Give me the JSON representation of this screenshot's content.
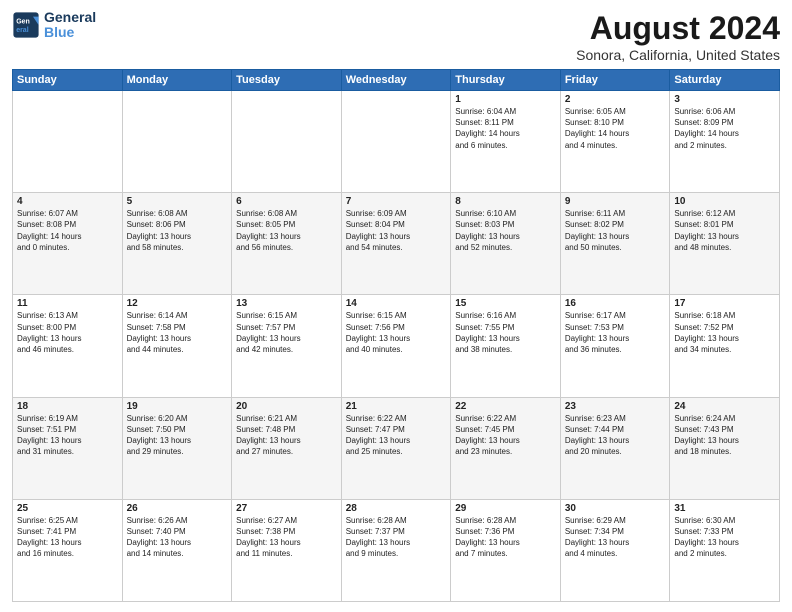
{
  "header": {
    "logo": {
      "line1": "General",
      "line2": "Blue"
    },
    "title": "August 2024",
    "subtitle": "Sonora, California, United States"
  },
  "days_of_week": [
    "Sunday",
    "Monday",
    "Tuesday",
    "Wednesday",
    "Thursday",
    "Friday",
    "Saturday"
  ],
  "weeks": [
    [
      {
        "day": "",
        "info": ""
      },
      {
        "day": "",
        "info": ""
      },
      {
        "day": "",
        "info": ""
      },
      {
        "day": "",
        "info": ""
      },
      {
        "day": "1",
        "info": "Sunrise: 6:04 AM\nSunset: 8:11 PM\nDaylight: 14 hours\nand 6 minutes."
      },
      {
        "day": "2",
        "info": "Sunrise: 6:05 AM\nSunset: 8:10 PM\nDaylight: 14 hours\nand 4 minutes."
      },
      {
        "day": "3",
        "info": "Sunrise: 6:06 AM\nSunset: 8:09 PM\nDaylight: 14 hours\nand 2 minutes."
      }
    ],
    [
      {
        "day": "4",
        "info": "Sunrise: 6:07 AM\nSunset: 8:08 PM\nDaylight: 14 hours\nand 0 minutes."
      },
      {
        "day": "5",
        "info": "Sunrise: 6:08 AM\nSunset: 8:06 PM\nDaylight: 13 hours\nand 58 minutes."
      },
      {
        "day": "6",
        "info": "Sunrise: 6:08 AM\nSunset: 8:05 PM\nDaylight: 13 hours\nand 56 minutes."
      },
      {
        "day": "7",
        "info": "Sunrise: 6:09 AM\nSunset: 8:04 PM\nDaylight: 13 hours\nand 54 minutes."
      },
      {
        "day": "8",
        "info": "Sunrise: 6:10 AM\nSunset: 8:03 PM\nDaylight: 13 hours\nand 52 minutes."
      },
      {
        "day": "9",
        "info": "Sunrise: 6:11 AM\nSunset: 8:02 PM\nDaylight: 13 hours\nand 50 minutes."
      },
      {
        "day": "10",
        "info": "Sunrise: 6:12 AM\nSunset: 8:01 PM\nDaylight: 13 hours\nand 48 minutes."
      }
    ],
    [
      {
        "day": "11",
        "info": "Sunrise: 6:13 AM\nSunset: 8:00 PM\nDaylight: 13 hours\nand 46 minutes."
      },
      {
        "day": "12",
        "info": "Sunrise: 6:14 AM\nSunset: 7:58 PM\nDaylight: 13 hours\nand 44 minutes."
      },
      {
        "day": "13",
        "info": "Sunrise: 6:15 AM\nSunset: 7:57 PM\nDaylight: 13 hours\nand 42 minutes."
      },
      {
        "day": "14",
        "info": "Sunrise: 6:15 AM\nSunset: 7:56 PM\nDaylight: 13 hours\nand 40 minutes."
      },
      {
        "day": "15",
        "info": "Sunrise: 6:16 AM\nSunset: 7:55 PM\nDaylight: 13 hours\nand 38 minutes."
      },
      {
        "day": "16",
        "info": "Sunrise: 6:17 AM\nSunset: 7:53 PM\nDaylight: 13 hours\nand 36 minutes."
      },
      {
        "day": "17",
        "info": "Sunrise: 6:18 AM\nSunset: 7:52 PM\nDaylight: 13 hours\nand 34 minutes."
      }
    ],
    [
      {
        "day": "18",
        "info": "Sunrise: 6:19 AM\nSunset: 7:51 PM\nDaylight: 13 hours\nand 31 minutes."
      },
      {
        "day": "19",
        "info": "Sunrise: 6:20 AM\nSunset: 7:50 PM\nDaylight: 13 hours\nand 29 minutes."
      },
      {
        "day": "20",
        "info": "Sunrise: 6:21 AM\nSunset: 7:48 PM\nDaylight: 13 hours\nand 27 minutes."
      },
      {
        "day": "21",
        "info": "Sunrise: 6:22 AM\nSunset: 7:47 PM\nDaylight: 13 hours\nand 25 minutes."
      },
      {
        "day": "22",
        "info": "Sunrise: 6:22 AM\nSunset: 7:45 PM\nDaylight: 13 hours\nand 23 minutes."
      },
      {
        "day": "23",
        "info": "Sunrise: 6:23 AM\nSunset: 7:44 PM\nDaylight: 13 hours\nand 20 minutes."
      },
      {
        "day": "24",
        "info": "Sunrise: 6:24 AM\nSunset: 7:43 PM\nDaylight: 13 hours\nand 18 minutes."
      }
    ],
    [
      {
        "day": "25",
        "info": "Sunrise: 6:25 AM\nSunset: 7:41 PM\nDaylight: 13 hours\nand 16 minutes."
      },
      {
        "day": "26",
        "info": "Sunrise: 6:26 AM\nSunset: 7:40 PM\nDaylight: 13 hours\nand 14 minutes."
      },
      {
        "day": "27",
        "info": "Sunrise: 6:27 AM\nSunset: 7:38 PM\nDaylight: 13 hours\nand 11 minutes."
      },
      {
        "day": "28",
        "info": "Sunrise: 6:28 AM\nSunset: 7:37 PM\nDaylight: 13 hours\nand 9 minutes."
      },
      {
        "day": "29",
        "info": "Sunrise: 6:28 AM\nSunset: 7:36 PM\nDaylight: 13 hours\nand 7 minutes."
      },
      {
        "day": "30",
        "info": "Sunrise: 6:29 AM\nSunset: 7:34 PM\nDaylight: 13 hours\nand 4 minutes."
      },
      {
        "day": "31",
        "info": "Sunrise: 6:30 AM\nSunset: 7:33 PM\nDaylight: 13 hours\nand 2 minutes."
      }
    ]
  ]
}
